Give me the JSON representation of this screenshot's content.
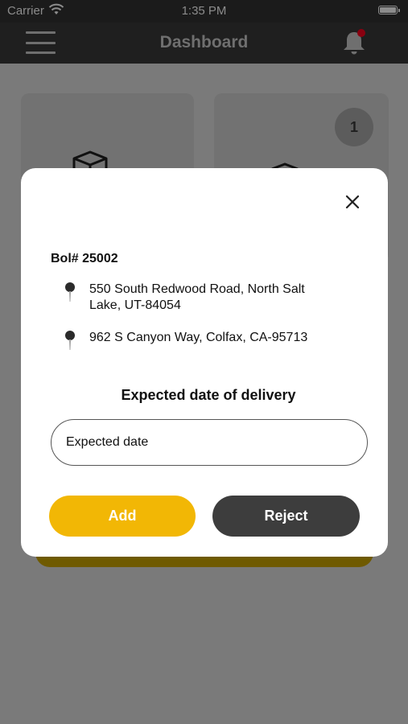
{
  "status_bar": {
    "carrier": "Carrier",
    "time": "1:35 PM"
  },
  "header": {
    "title": "Dashboard",
    "notification_dot_color": "#d0021b"
  },
  "dashboard": {
    "cards": [
      {
        "icon": "box-icon"
      },
      {
        "icon": "box-icon",
        "badge": "1"
      }
    ]
  },
  "modal": {
    "bol": "Bol# 25002",
    "addresses": [
      "550 South Redwood Road, North Salt Lake, UT-84054",
      "962 S Canyon Way, Colfax, CA-95713"
    ],
    "delivery_label": "Expected date of delivery",
    "date_input": {
      "placeholder": "Expected date",
      "value": ""
    },
    "add_label": "Add",
    "reject_label": "Reject"
  },
  "colors": {
    "accent_yellow": "#f2b705",
    "dark_button": "#3d3d3d",
    "header_bg": "#1f1f1f"
  }
}
